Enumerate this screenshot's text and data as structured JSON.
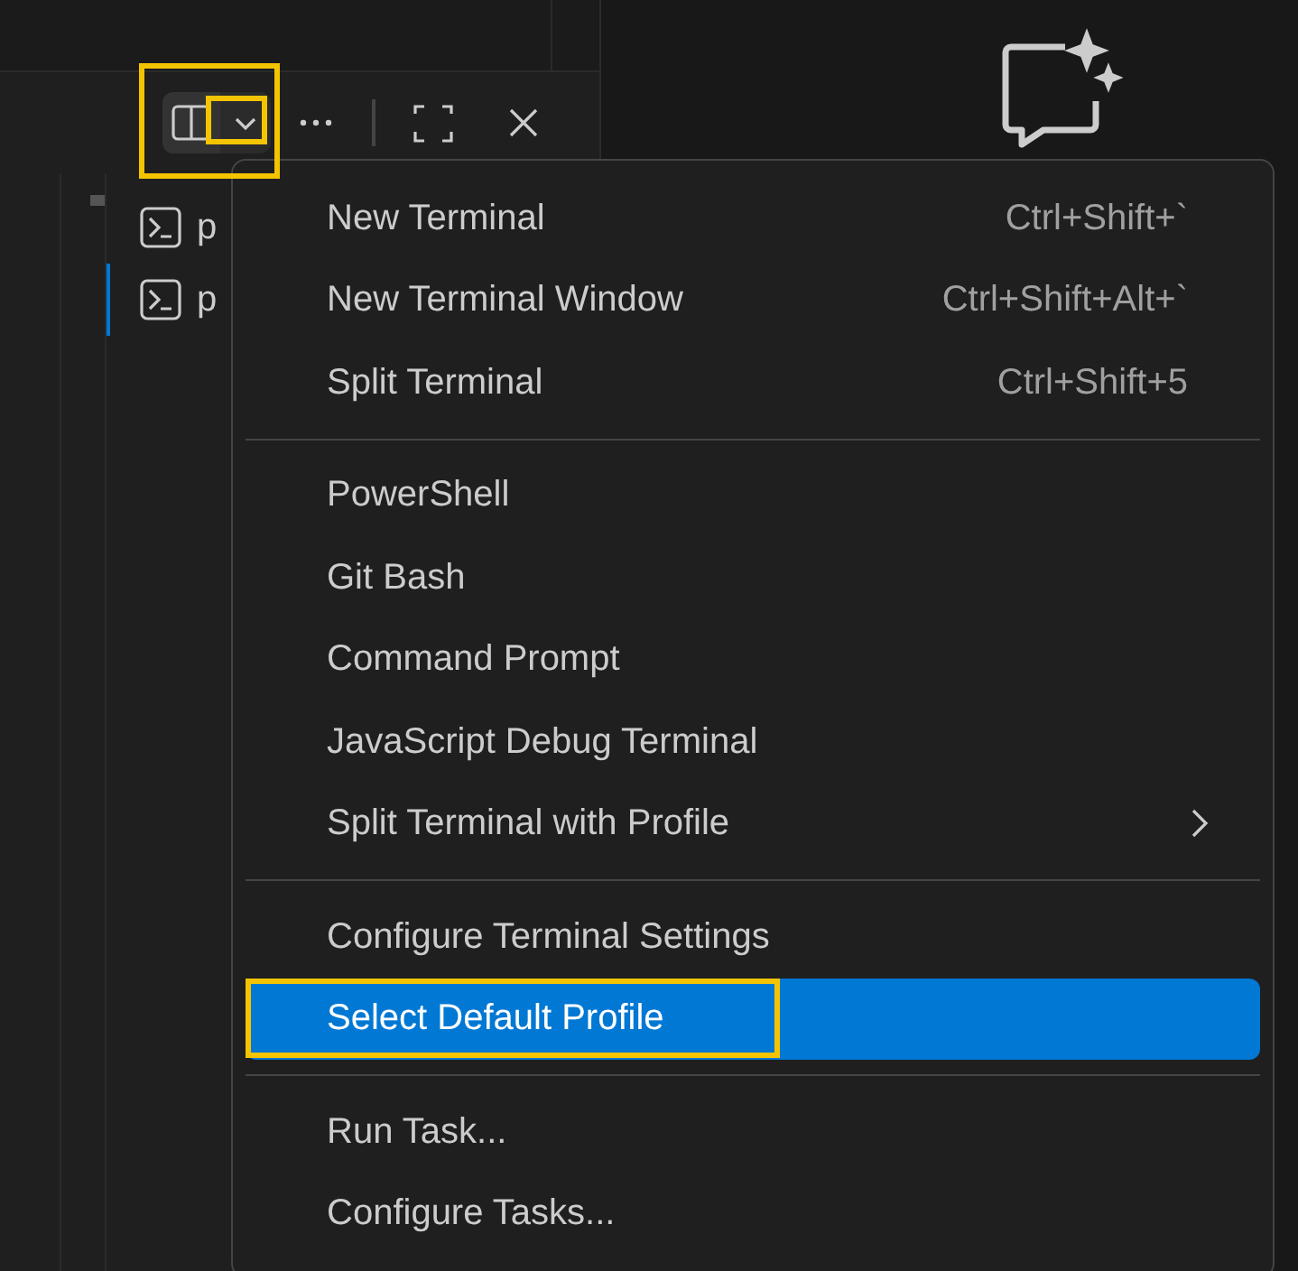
{
  "terminal_list": [
    {
      "label": "p",
      "selected": false
    },
    {
      "label": "p",
      "selected": true
    }
  ],
  "menu": {
    "sections": [
      [
        {
          "label": "New Terminal",
          "shortcut": "Ctrl+Shift+`",
          "selected": false
        },
        {
          "label": "New Terminal Window",
          "shortcut": "Ctrl+Shift+Alt+`",
          "selected": false
        },
        {
          "label": "Split Terminal",
          "shortcut": "Ctrl+Shift+5",
          "selected": false
        }
      ],
      [
        {
          "label": "PowerShell",
          "selected": false
        },
        {
          "label": "Git Bash",
          "selected": false
        },
        {
          "label": "Command Prompt",
          "selected": false
        },
        {
          "label": "JavaScript Debug Terminal",
          "selected": false
        },
        {
          "label": "Split Terminal with Profile",
          "submenu": true,
          "selected": false
        }
      ],
      [
        {
          "label": "Configure Terminal Settings",
          "selected": false
        },
        {
          "label": "Select Default Profile",
          "selected": true
        }
      ],
      [
        {
          "label": "Run Task...",
          "selected": false
        },
        {
          "label": "Configure Tasks...",
          "selected": false
        }
      ]
    ]
  }
}
